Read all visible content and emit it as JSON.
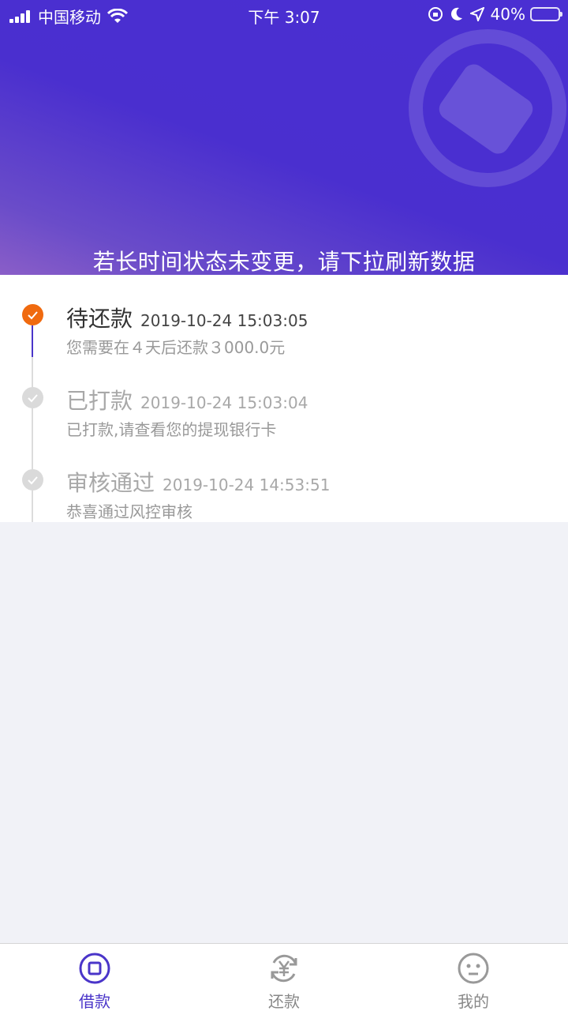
{
  "status_bar": {
    "carrier": "中国移动",
    "time": "下午 3:07",
    "battery": "40%"
  },
  "header": {
    "hint": "若长时间状态未变更，请下拉刷新数据"
  },
  "colors": {
    "brand": "#4a2fd2",
    "accent": "#f06a0f",
    "muted": "#a8a8a8"
  },
  "timeline": {
    "steps": [
      {
        "title": "待还款",
        "time": "2019-10-24 15:03:05",
        "desc": "您需要在４天后还款３000.0元",
        "state": "active"
      },
      {
        "title": "已打款",
        "time": "2019-10-24 15:03:04",
        "desc": "已打款,请查看您的提现银行卡",
        "state": "done"
      },
      {
        "title": "审核通过",
        "time": "2019-10-24 14:53:51",
        "desc": "恭喜通过风控审核",
        "state": "done"
      }
    ]
  },
  "tabbar": {
    "tabs": [
      {
        "label": "借款",
        "icon": "loan-square-icon",
        "active": true
      },
      {
        "label": "还款",
        "icon": "yen-cycle-icon",
        "active": false
      },
      {
        "label": "我的",
        "icon": "face-icon",
        "active": false
      }
    ]
  }
}
